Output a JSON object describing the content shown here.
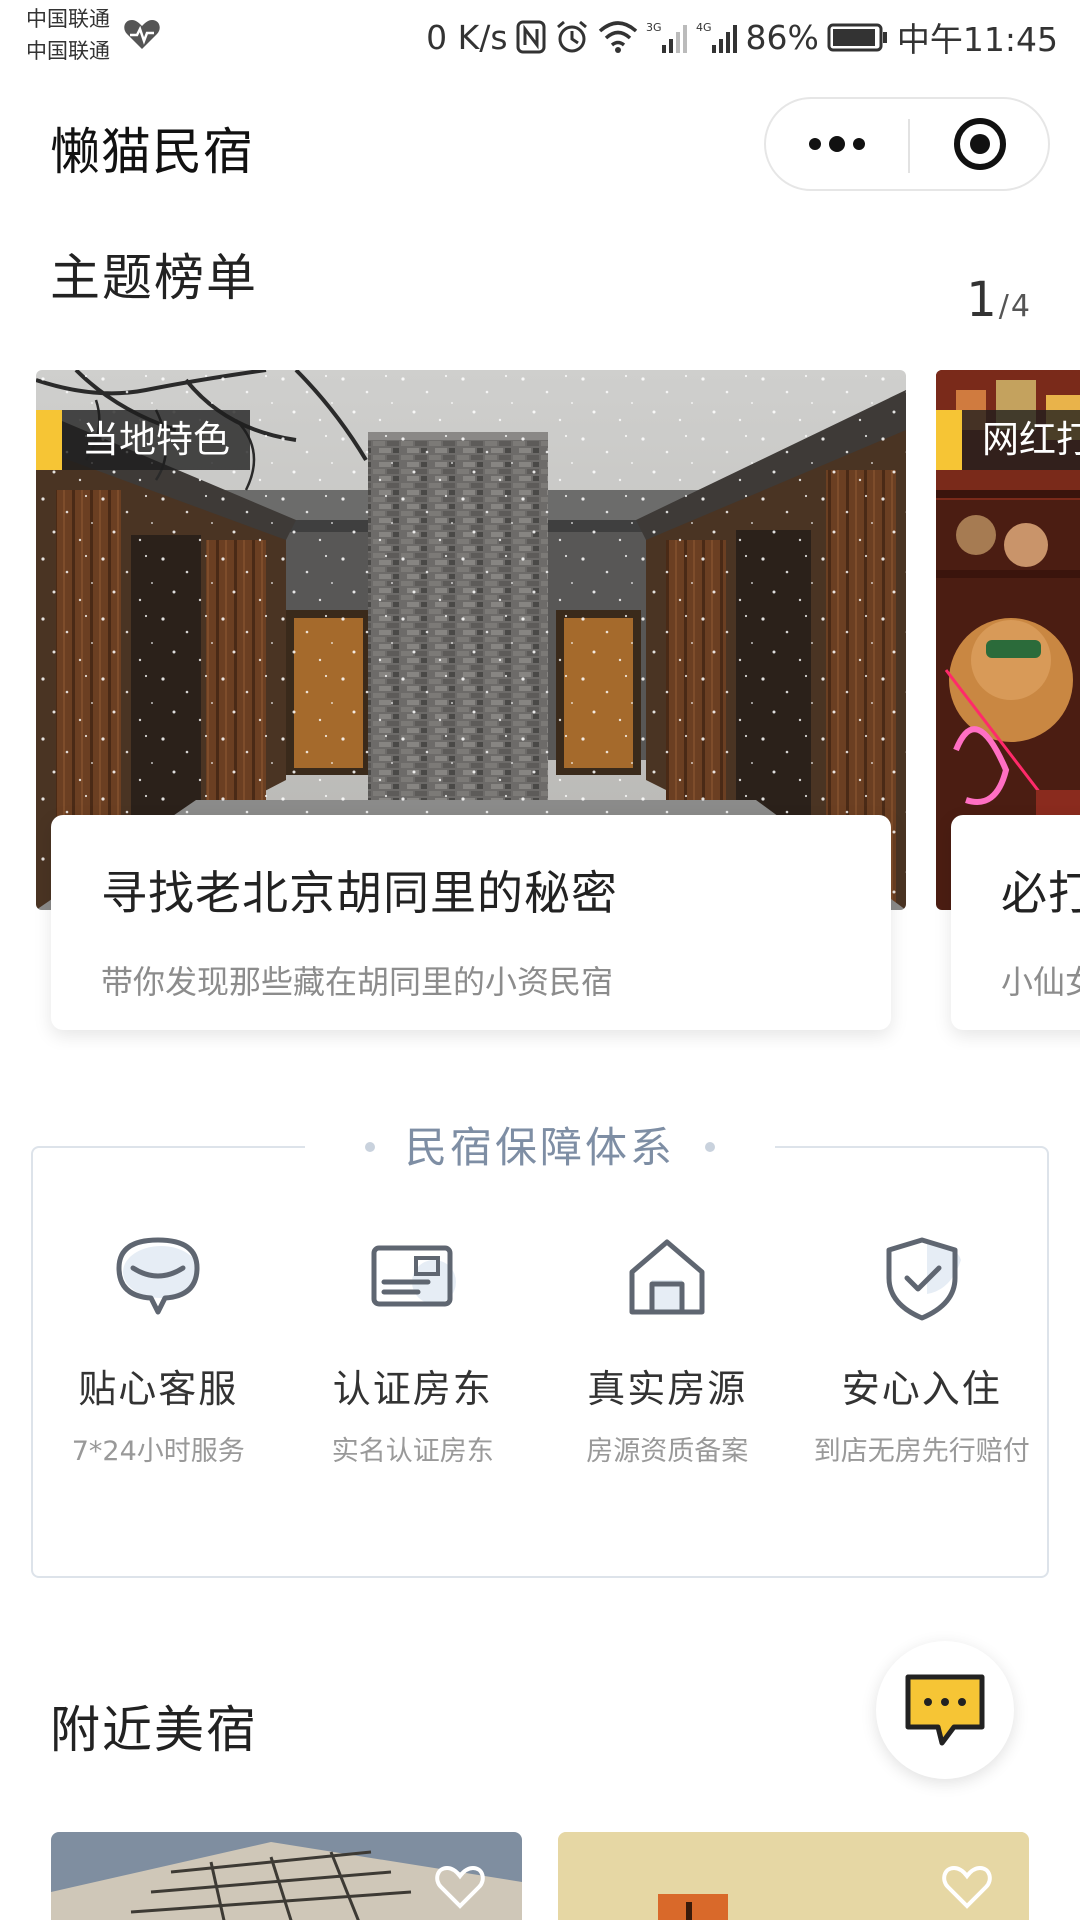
{
  "status_bar": {
    "carrier_1": "中国联通",
    "carrier_2": "中国联通",
    "speed": "0 K/s",
    "battery": "86%",
    "time": "中午11:45"
  },
  "header": {
    "title": "懒猫民宿"
  },
  "themes": {
    "title": "主题榜单",
    "pager_current": "1",
    "pager_separator": "/",
    "pager_total": "4",
    "cards": [
      {
        "tag": "当地特色",
        "title": "寻找老北京胡同里的秘密",
        "subtitle": "带你发现那些藏在胡同里的小资民宿"
      },
      {
        "tag": "网红打",
        "title": "必打",
        "subtitle": "小仙女"
      }
    ]
  },
  "guarantee": {
    "title": "民宿保障体系",
    "items": [
      {
        "name": "贴心客服",
        "desc": "7*24小时服务",
        "icon": "chat-bubble-icon"
      },
      {
        "name": "认证房东",
        "desc": "实名认证房东",
        "icon": "id-card-icon"
      },
      {
        "name": "真实房源",
        "desc": "房源资质备案",
        "icon": "house-icon"
      },
      {
        "name": "安心入住",
        "desc": "到店无房先行赔付",
        "icon": "shield-check-icon"
      }
    ]
  },
  "nearby": {
    "title": "附近美宿"
  },
  "colors": {
    "accent_yellow": "#f6c535",
    "guarantee_title": "#7e8ea4",
    "border": "#dde3ea"
  }
}
